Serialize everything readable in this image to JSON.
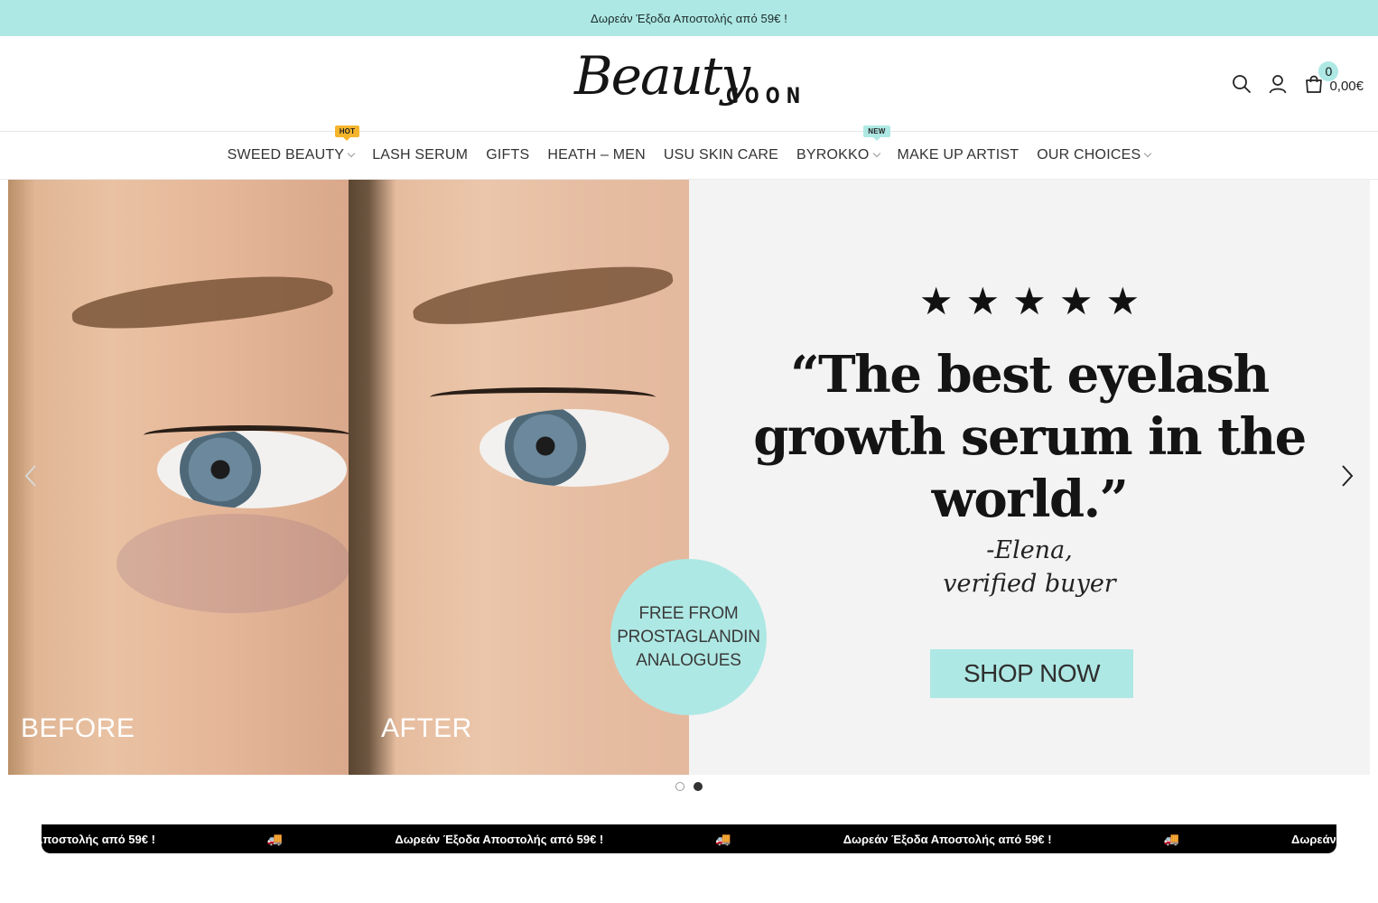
{
  "topbar": {
    "text": "Δωρεάν Έξοδα Αποστολής από 59€ !"
  },
  "logo": {
    "script": "Beauty",
    "word": "COON"
  },
  "header": {
    "search_icon": "search-icon",
    "account_icon": "user-icon",
    "cart_icon": "shopping-bag-icon",
    "cart_count": "0",
    "cart_total": "0,00€"
  },
  "nav": {
    "items": [
      {
        "label": "SWEED BEAUTY",
        "badge": "HOT",
        "dropdown": true
      },
      {
        "label": "LASH SERUM"
      },
      {
        "label": "GIFTS"
      },
      {
        "label": "HEATH – MEN"
      },
      {
        "label": "USU SKIN CARE"
      },
      {
        "label": "BYROKKO",
        "badge": "NEW",
        "dropdown": true
      },
      {
        "label": "MAKE UP ARTIST"
      },
      {
        "label": "OUR CHOICES",
        "dropdown": true
      }
    ]
  },
  "slide": {
    "before_label": "BEFORE",
    "after_label": "AFTER",
    "badge_lines": [
      "FREE FROM",
      "PROSTAGLANDIN",
      "ANALOGUES"
    ],
    "stars": "★★★★★",
    "quote": "“The best eyelash growth serum in the world.”",
    "author_line1": "-Elena,",
    "author_line2": "verified buyer",
    "cta": "SHOP NOW"
  },
  "slider_dots": {
    "count": 2,
    "active_index": 1
  },
  "marquee": {
    "text": "Δωρεάν Έξοδα Αποστολής από 59€ !",
    "icon": "truck-icon"
  },
  "colors": {
    "accent": "#aee8e4",
    "hot_badge": "#f5b52b",
    "marquee_bg": "#000000"
  }
}
